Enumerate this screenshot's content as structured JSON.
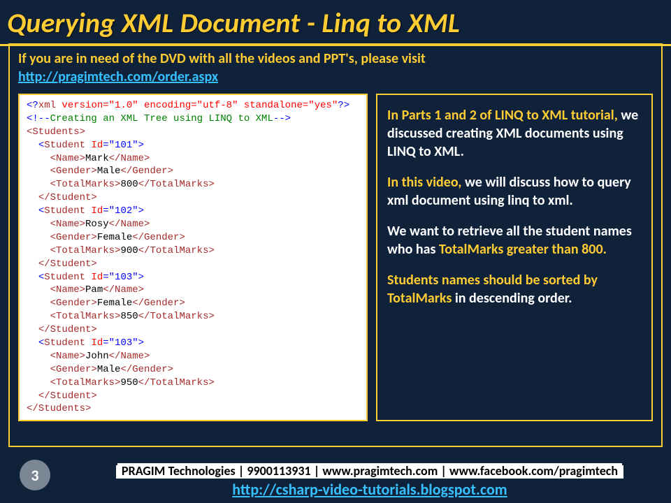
{
  "title": "Querying XML Document - Linq to XML",
  "intro": {
    "line": "If you are in need of the DVD with all the videos and PPT's, please visit",
    "link": "http://pragimtech.com/order.aspx"
  },
  "xml": {
    "decl_open": "<?",
    "decl_xml": "xml",
    "decl_attrs": " version=\"1.0\" encoding=\"utf-8\" standalone=\"yes\"",
    "decl_close": "?>",
    "comment_open": "<!--",
    "comment_text": "Creating an XML Tree using LINQ to XML",
    "comment_close": "-->",
    "students_open": "<Students>",
    "students_close": "</Students>",
    "student_close": "</Student>",
    "name_open": "<Name>",
    "name_close": "</Name>",
    "gender_open": "<Gender>",
    "gender_close": "</Gender>",
    "marks_open": "<TotalMarks>",
    "marks_close": "</TotalMarks>",
    "students": [
      {
        "id": "101",
        "name": "Mark",
        "gender": "Male",
        "marks": "800"
      },
      {
        "id": "102",
        "name": "Rosy",
        "gender": "Female",
        "marks": "900"
      },
      {
        "id": "103",
        "name": "Pam",
        "gender": "Female",
        "marks": "850"
      },
      {
        "id": "103",
        "name": "John",
        "gender": "Male",
        "marks": "950"
      }
    ]
  },
  "side": {
    "p1_a": "In Parts 1 and 2 of LINQ to XML tutorial,",
    "p1_b": " we discussed creating XML documents using LINQ to XML.",
    "p2_a": "In this video,",
    "p2_b": " we will discuss how to query xml document using linq to xml.",
    "p3_a": "We want to retrieve all the student names who has ",
    "p3_b": "TotalMarks greater than 800.",
    "p4_a": "Students names should be sorted by TotalMarks",
    "p4_b": " in descending order."
  },
  "footer": {
    "page": "3",
    "line1": "PRAGIM Technologies | 9900113931 | www.pragimtech.com | www.facebook.com/pragimtech",
    "link": "http://csharp-video-tutorials.blogspot.com"
  }
}
